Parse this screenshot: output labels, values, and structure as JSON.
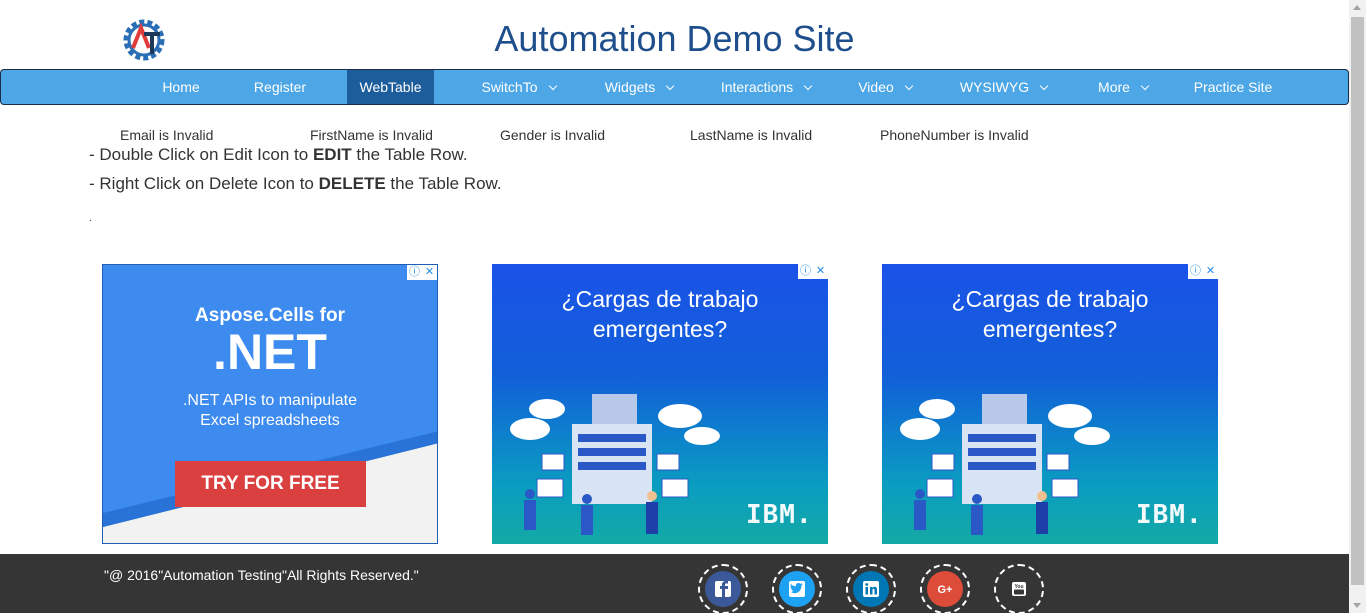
{
  "header": {
    "title": "Automation Demo Site"
  },
  "nav": {
    "items": [
      {
        "label": "Home",
        "dropdown": false,
        "active": false
      },
      {
        "label": "Register",
        "dropdown": false,
        "active": false
      },
      {
        "label": "WebTable",
        "dropdown": false,
        "active": true
      },
      {
        "label": "SwitchTo",
        "dropdown": true,
        "active": false
      },
      {
        "label": "Widgets",
        "dropdown": true,
        "active": false
      },
      {
        "label": "Interactions",
        "dropdown": true,
        "active": false
      },
      {
        "label": "Video",
        "dropdown": true,
        "active": false
      },
      {
        "label": "WYSIWYG",
        "dropdown": true,
        "active": false
      },
      {
        "label": "More",
        "dropdown": true,
        "active": false
      },
      {
        "label": "Practice Site",
        "dropdown": false,
        "active": false
      }
    ]
  },
  "validation": {
    "email": "Email is Invalid",
    "firstname": "FirstName is Invalid",
    "gender": "Gender is Invalid",
    "lastname": "LastName is Invalid",
    "phone": "PhoneNumber is Invalid"
  },
  "instructions": {
    "line1_prefix": "- Double Click on Edit Icon to ",
    "line1_bold": "EDIT",
    "line1_suffix": " the Table Row.",
    "line2_prefix": "- Right Click on Delete Icon to ",
    "line2_bold": "DELETE",
    "line2_suffix": " the Table Row.",
    "dot": "."
  },
  "ads": {
    "aspose": {
      "line1": "Aspose.Cells for",
      "line2": ".NET",
      "line3": ".NET APIs to manipulate",
      "line4": "Excel spreadsheets",
      "button": "TRY FOR FREE"
    },
    "ibm1": {
      "line1": "¿Cargas de trabajo",
      "line2": "emergentes?",
      "brand": "IBM."
    },
    "ibm2": {
      "line1": "¿Cargas de trabajo",
      "line2": "emergentes?",
      "brand": "IBM."
    },
    "controls": {
      "info": "ⓘ",
      "close": "✕"
    }
  },
  "footer": {
    "copyright": "\"@ 2016\"Automation Testing\"All Rights Reserved.\"",
    "social": [
      {
        "name": "facebook",
        "glyph": "f",
        "color": "#3b5998"
      },
      {
        "name": "twitter",
        "glyph": "t",
        "color": "#1da1f2"
      },
      {
        "name": "linkedin",
        "glyph": "in",
        "color": "#0077b5"
      },
      {
        "name": "google-plus",
        "glyph": "G+",
        "color": "#dd4b39"
      },
      {
        "name": "youtube",
        "glyph": "You",
        "color": "#353535"
      }
    ]
  },
  "colors": {
    "nav_bg": "#4da6e6",
    "nav_active": "#1e5d9c",
    "title": "#1e4f8c",
    "footer_bg": "#353535"
  }
}
